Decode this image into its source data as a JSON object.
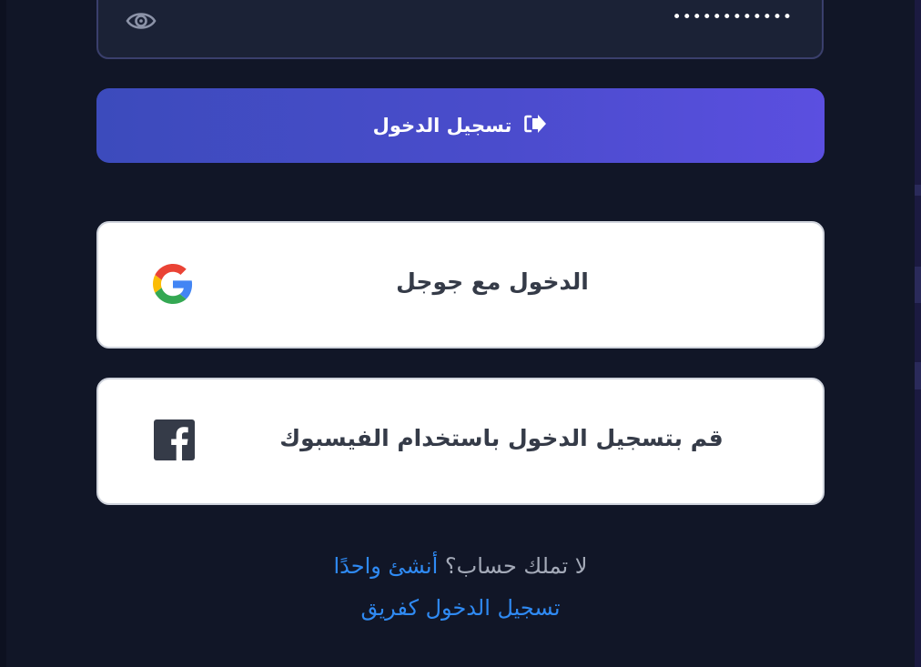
{
  "password": {
    "value": "••••••••••••"
  },
  "login_button": {
    "label": "تسجيل الدخول",
    "icon": "sign-in-icon"
  },
  "google_button": {
    "label": "الدخول مع جوجل",
    "icon": "google-icon"
  },
  "facebook_button": {
    "label": "قم بتسجيل الدخول باستخدام الفيسبوك",
    "icon": "facebook-icon"
  },
  "signup": {
    "prompt": "لا تملك حساب؟",
    "link": "أنشئ واحدًا"
  },
  "team_login": {
    "label": "تسجيل الدخول كفريق"
  },
  "colors": {
    "background": "#111627",
    "accent_start": "#3c4bbc",
    "accent_end": "#5b4fe0",
    "link": "#2f8af3"
  }
}
